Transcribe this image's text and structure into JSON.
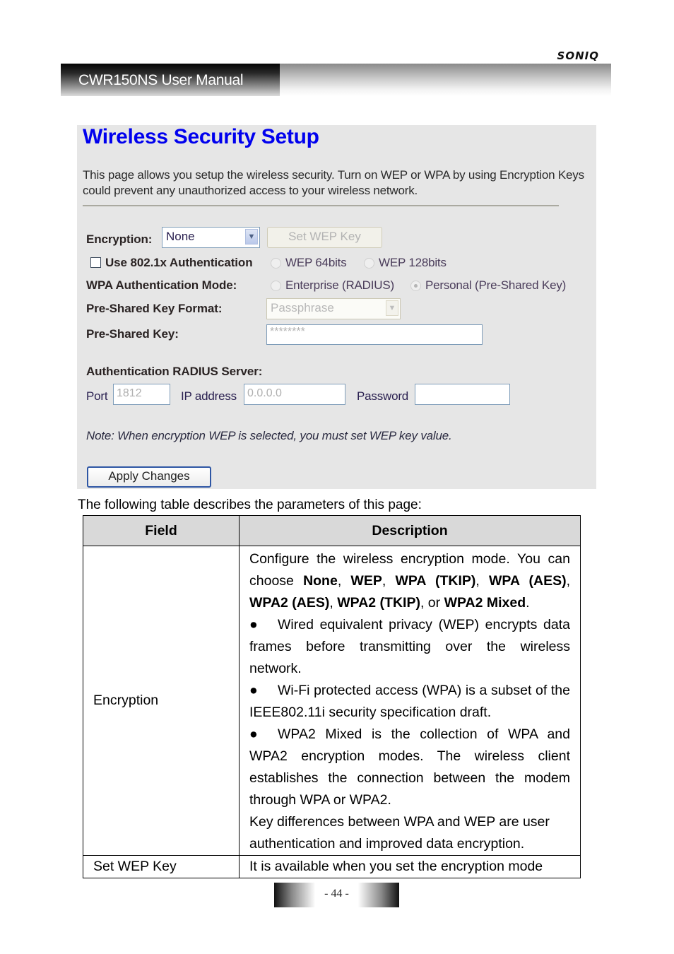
{
  "header": {
    "brand": "SONIQ",
    "manual_title": "CWR150NS User Manual"
  },
  "screenshot": {
    "title": "Wireless Security Setup",
    "intro": "This page allows you setup the wireless security. Turn on WEP or WPA by using Encryption Keys could prevent any unauthorized access to your wireless network.",
    "encryption": {
      "label": "Encryption:",
      "value": "None"
    },
    "set_wep_key_button": "Set WEP Key",
    "use_8021x": {
      "label": "Use 802.1x Authentication",
      "checked": false
    },
    "wep_64": "WEP 64bits",
    "wep_128": "WEP 128bits",
    "wpa_auth_mode": {
      "label": "WPA Authentication Mode:",
      "options": [
        "Enterprise (RADIUS)",
        "Personal (Pre-Shared Key)"
      ],
      "selected": "Personal (Pre-Shared Key)"
    },
    "psk_format": {
      "label": "Pre-Shared Key Format:",
      "value": "Passphrase"
    },
    "psk": {
      "label": "Pre-Shared Key:",
      "value": "********"
    },
    "radius": {
      "label": "Authentication RADIUS Server:",
      "port_label": "Port",
      "port_value": "1812",
      "ip_label": "IP address",
      "ip_value": "0.0.0.0",
      "password_label": "Password",
      "password_value": ""
    },
    "note": "Note: When encryption WEP is selected, you must set WEP key value.",
    "apply_button": "Apply Changes"
  },
  "doc": {
    "table_intro": "The following table describes the parameters of this page:",
    "table": {
      "headers": [
        "Field",
        "Description"
      ],
      "rows": [
        {
          "field": "Encryption",
          "desc_intro_1": "Configure the wireless encryption mode. You can choose ",
          "modes": [
            "None",
            "WEP",
            "WPA (TKIP)",
            "WPA (AES)",
            "WPA2 (AES)",
            "WPA2 (TKIP)",
            "WPA2 Mixed"
          ],
          "sep": ", ",
          "or": ", or ",
          "period": ".",
          "bullets": [
            "Wired equivalent privacy (WEP) encrypts data frames before transmitting over the wireless network.",
            "Wi-Fi protected access (WPA) is a subset of the IEEE802.11i security specification draft.",
            "WPA2 Mixed is the collection of WPA and WPA2 encryption modes. The wireless client establishes the connection between the modem through WPA or WPA2."
          ],
          "closing": "Key differences between WPA and WEP are user authentication and improved data encryption."
        },
        {
          "field": "Set WEP Key",
          "desc": "It is available when you set the encryption mode"
        }
      ]
    }
  },
  "footer": {
    "page_number": "- 44 -"
  }
}
